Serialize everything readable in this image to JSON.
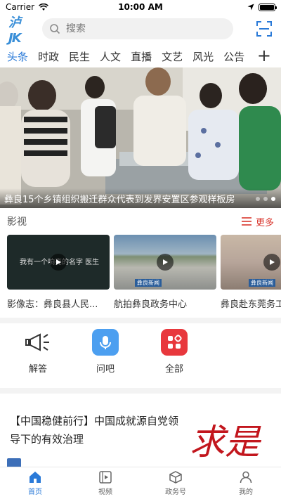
{
  "status_bar": {
    "carrier": "Carrier",
    "time": "10:00 AM"
  },
  "header": {
    "logo_text": "泸JK",
    "search_placeholder": "搜索"
  },
  "tabs": [
    "头条",
    "时政",
    "民生",
    "人文",
    "直播",
    "文艺",
    "风光",
    "公告"
  ],
  "tabs_add": "+",
  "hero": {
    "caption": "彝良15个乡镇组织搬迁群众代表到发界安置区参观样板房",
    "slide_count": 3,
    "active_slide": 3
  },
  "video_section": {
    "title": "影视",
    "more_label": "更多",
    "items": [
      {
        "title": "影像志：彝良县人民...",
        "overlay": "我有一个响亮的名字 医生"
      },
      {
        "title": "航拍彝良政务中心",
        "overlay": "彝良新闻"
      },
      {
        "title": "彝良赴东莞务工",
        "overlay": "彝良新闻"
      }
    ]
  },
  "services": [
    {
      "label": "解答",
      "icon": "megaphone-icon"
    },
    {
      "label": "问吧",
      "icon": "microphone-icon"
    },
    {
      "label": "全部",
      "icon": "grid-icon"
    }
  ],
  "article": {
    "title": "【中国稳健前行】中国成就源自党领导下的有效治理",
    "image_text": "求是"
  },
  "bottom_nav": [
    {
      "label": "首页",
      "icon": "home-icon"
    },
    {
      "label": "视频",
      "icon": "video-icon"
    },
    {
      "label": "政务号",
      "icon": "cube-icon"
    },
    {
      "label": "我的",
      "icon": "user-icon"
    }
  ],
  "colors": {
    "accent": "#2a7ad8",
    "more": "#d9352c"
  }
}
